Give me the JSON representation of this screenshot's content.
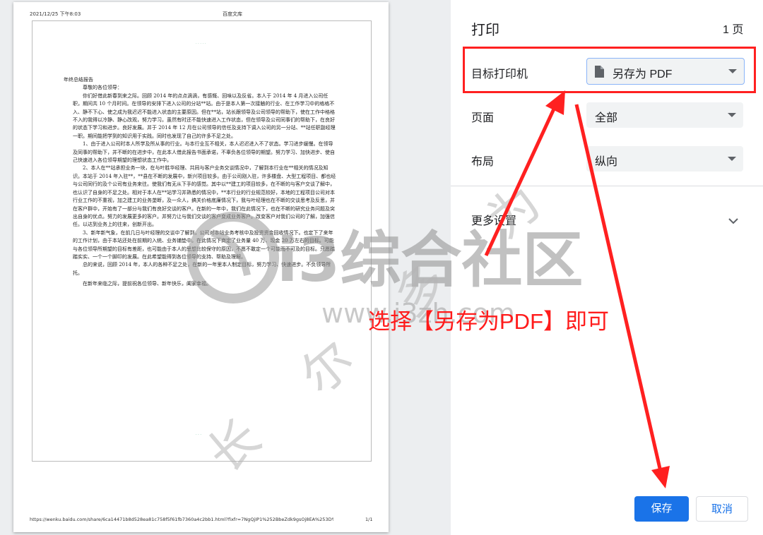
{
  "preview": {
    "header_date": "2021/12/25 下午8:03",
    "header_title": "百度文库",
    "doc_title": "年终总结报告",
    "greeting": "尊敬的各位领导：",
    "paragraphs": [
      "你们好借此新春到来之际。回顾 2014 年的点点滴滴，有感慨、回味以及反省。本人于 2014 年 4 月进入公司任职，期间共 10 个月时间。在领导的安排下进入公司的分站**站。由于是本人第一次接触的行业、在工作学习中的格格不入、静不下心、使之成为我迟迟不能进入状态的主要原因。但在**站，站长跟领导及公司领导的帮助下，使在工作中格格不入的我得以冷静、静心改观，努力学习。虽然有时还不能快速进入工作状态，但在领导及公司同事们的帮助下，在良好的状态下学习和进步。良好发展。并于 2014 年 12 月在公司领导的信任及支持下调入公司的另一分站、**站任职副经理一职。期间能把学到的知识用于实践。同时也发现了自己的许多不足之处。",
      "1、由于进入公司时本人所学及所从事的行业。与本行业互不相关，本人迟迟进入不了状态。学习进步缓慢。在领导及同事的帮助下，并不断的在进步中，在此本人借此报告书面承诺，不辜负各位领导的期望。努力学习、加快进步、使自己快速进入各位领导期望的理想状态工作中。",
      "2、本人在**站承担业务一块，在与叶胜华经理、共同与客户业务交谈情况中，了解到本行业在**相关的情况及知识。本站于 2014 年入驻**，**县在不断的发展中，新兴项目较多。由于公司刚入驻，许多楼盘、大型工程项目、都也经与公司同行的及个公司有业务来往。使我们有无从下手的感觉。其中以**建工的项目较多，在不断的与客户交谈了解中，也认识了自身的不足之处。相对于本人在**站学习并熟悉的情况中，**本行业的行业规范较好，本地的工程项目公司对本行业工作的不重视，加之建工的业务垄断，及一众人，搞关价格底廉情况下，我与叶经理也在不断的交谈思考及反思，并在客户群中，开始有了一部分与我们有良好交谈的客户。在新的一年中，我们在此情况下，也在不断的研究业务问题及突出自身的优点。努力的发展更多的客户。并努力让与我们交谈的客户变成业务客户。改变客户对我们公司的了解，加强信任。以达到业务上的往来，创新开出。",
      "3、新年新气象，在前几日与叶经理的交谈中了解到，公司对本站业务考核中及投资资金回收情况下。也定下了来年的工作计划，由于本站还处在前期的入统、业务铺垫中。在此情况下商定了业务量 40 万、现金 20 万左右的目标。可能与各位领导所期望的目标有差距，也可能由于本人的思想比较保守的原因，不愿不敢定一个可能而不可及的目标。只愿踏踏实实、一个一个脚印的发展。在此希望能得到各位领导的支持、帮助及理解。",
      "总的来说，回顾 2014 年，本人的各种不足之处，在新的一年里本人制定目标，努力学习、快速进步。不负领导所托。",
      "在新年来临之际，提前祝各位领导、新年快乐，阖家幸福。"
    ],
    "footer_url": "https://wenku.baidu.com/share/6ca14471b8d528ea81c758f5f61fb7360a4c2bb1.html?fixfr=7NgQjIP1%252BbeZdk9gsOj8EA%253D%253D&fr=in...",
    "footer_page": "1/1"
  },
  "panel": {
    "title": "打印",
    "page_count": "1 页",
    "rows": [
      {
        "label": "目标打印机",
        "value": "另存为 PDF",
        "icon": "document-icon"
      },
      {
        "label": "页面",
        "value": "全部"
      },
      {
        "label": "布局",
        "value": "纵向"
      }
    ],
    "more_settings": "更多设置",
    "save_label": "保存",
    "cancel_label": "取消"
  },
  "overlay": {
    "caption": "选择【另存为PDF】即可",
    "watermark_cn": "i3综合社区",
    "watermark_url": "www.i3zh.com",
    "watermark_hand": "长 尔 多 为"
  },
  "colors": {
    "accent": "#1a73e8",
    "annotation": "#ff1b1b"
  }
}
